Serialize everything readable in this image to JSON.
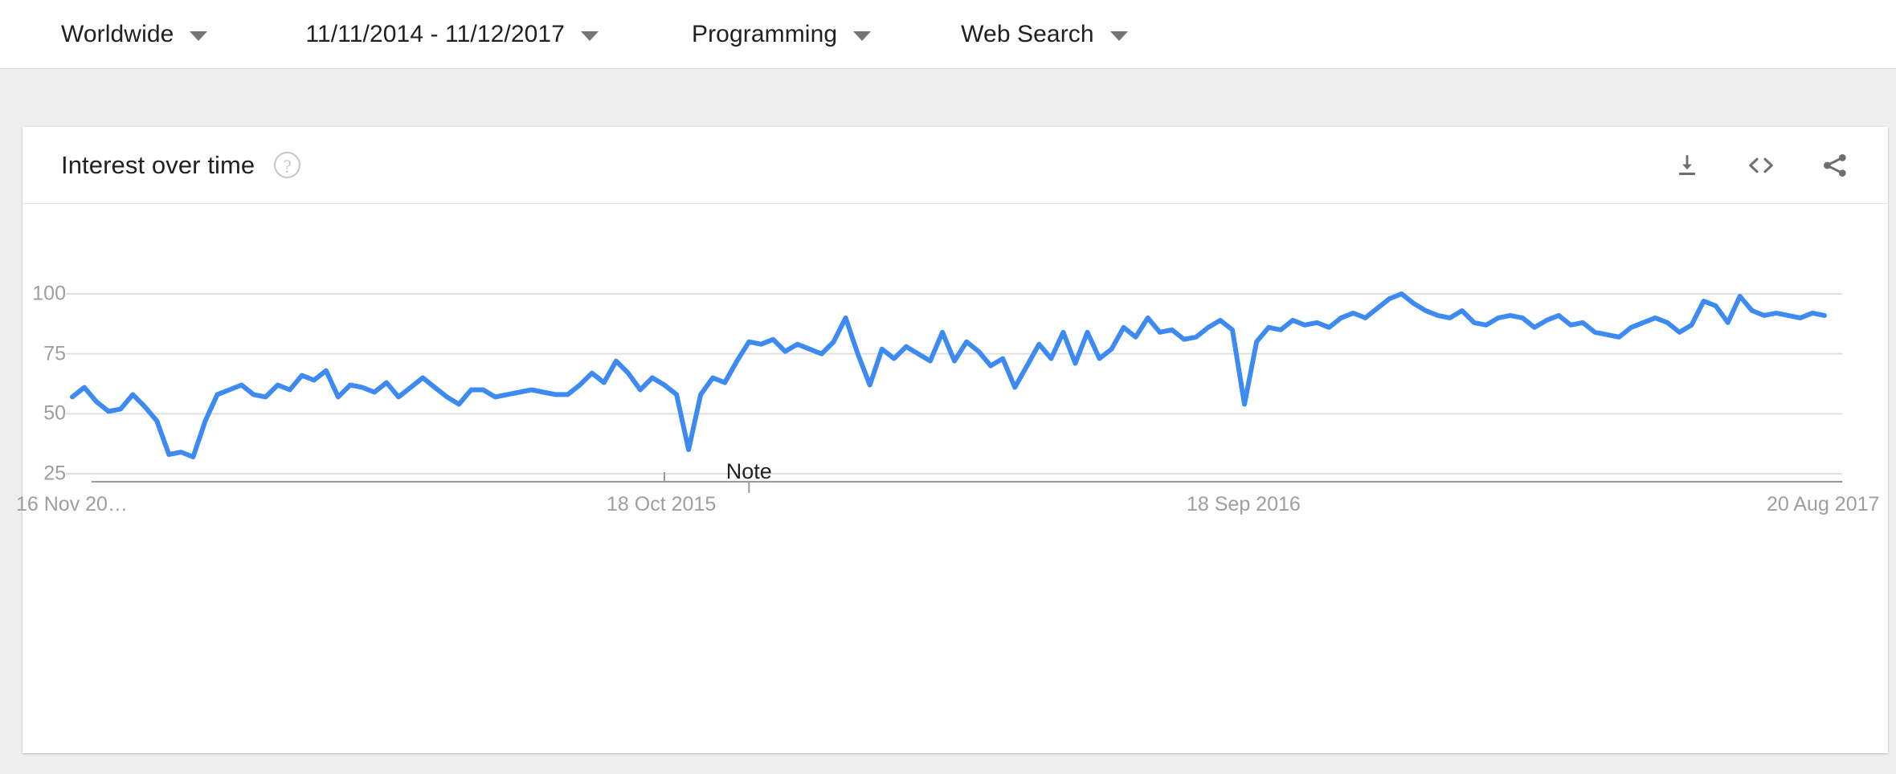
{
  "topbar": {
    "filters": [
      {
        "label": "Worldwide",
        "name": "location-filter"
      },
      {
        "label": "11/11/2014 - 11/12/2017",
        "name": "date-range-filter"
      },
      {
        "label": "Programming",
        "name": "category-filter"
      },
      {
        "label": "Web Search",
        "name": "search-type-filter"
      }
    ]
  },
  "card": {
    "title": "Interest over time",
    "help_icon": "help-circle-icon",
    "actions": [
      {
        "name": "download-csv-button",
        "icon": "download-icon"
      },
      {
        "name": "embed-code-button",
        "icon": "embed-code-icon"
      },
      {
        "name": "share-button",
        "icon": "share-icon"
      }
    ]
  },
  "colors": {
    "line": "#3d8bf2",
    "gridline": "#e0e0e0",
    "axis": "#9e9e9e",
    "tick_text": "#9e9e9e",
    "card_bg": "#ffffff",
    "page_bg": "#eeeeee"
  },
  "chart_data": {
    "type": "line",
    "title": "Interest over time",
    "xlabel": "",
    "ylabel": "",
    "ylim": [
      0,
      110
    ],
    "yticks": [
      25,
      50,
      75,
      100
    ],
    "grid": true,
    "legend": false,
    "x_tick_labels": [
      {
        "label": "16 Nov 20…",
        "index": 0
      },
      {
        "label": "18 Oct 2015",
        "index": 49
      },
      {
        "label": "18 Sep 2016",
        "index": 97
      },
      {
        "label": "20 Aug 2017",
        "index": 145
      }
    ],
    "annotations": [
      {
        "text": "Note",
        "index": 56
      }
    ],
    "series": [
      {
        "name": "Programming",
        "values": [
          57,
          61,
          55,
          51,
          52,
          58,
          53,
          47,
          33,
          34,
          32,
          47,
          58,
          60,
          62,
          58,
          57,
          62,
          60,
          66,
          64,
          68,
          57,
          62,
          61,
          59,
          63,
          57,
          61,
          65,
          61,
          57,
          54,
          60,
          60,
          57,
          58,
          59,
          60,
          59,
          58,
          58,
          62,
          67,
          63,
          72,
          67,
          60,
          65,
          62,
          58,
          35,
          58,
          65,
          63,
          72,
          80,
          79,
          81,
          76,
          79,
          77,
          75,
          80,
          90,
          75,
          62,
          77,
          73,
          78,
          75,
          72,
          84,
          72,
          80,
          76,
          70,
          73,
          61,
          70,
          79,
          73,
          84,
          71,
          84,
          73,
          77,
          86,
          82,
          90,
          84,
          85,
          81,
          82,
          86,
          89,
          85,
          54,
          80,
          86,
          85,
          89,
          87,
          88,
          86,
          90,
          92,
          90,
          94,
          98,
          100,
          96,
          93,
          91,
          90,
          93,
          88,
          87,
          90,
          91,
          90,
          86,
          89,
          91,
          87,
          88,
          84,
          83,
          82,
          86,
          88,
          90,
          88,
          84,
          87,
          97,
          95,
          88,
          99,
          93,
          91,
          92,
          91,
          90,
          92,
          91
        ]
      }
    ]
  }
}
